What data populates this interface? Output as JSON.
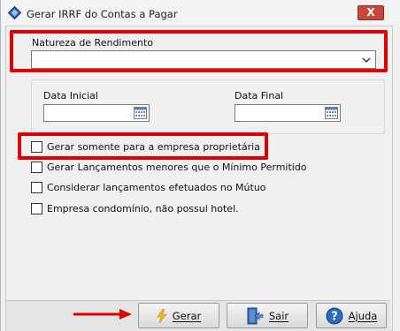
{
  "window": {
    "title": "Gerar IRRF do Contas a Pagar",
    "close_label": "X"
  },
  "form": {
    "natureza_label": "Natureza de Rendimento",
    "natureza_value": "",
    "data_inicial_label": "Data Inicial",
    "data_inicial_value": "",
    "data_final_label": "Data Final",
    "data_final_value": ""
  },
  "checkboxes": [
    {
      "label": "Gerar somente para a empresa proprietária",
      "checked": false
    },
    {
      "label": "Gerar Lançamentos menores que o Mínimo Permitido",
      "checked": false
    },
    {
      "label": "Considerar lançamentos efetuados no Mútuo",
      "checked": false
    },
    {
      "label": "Empresa condomínio, não possui hotel.",
      "checked": false
    }
  ],
  "buttons": {
    "gerar": "Gerar",
    "sair": "Sair",
    "ajuda": "Ajuda"
  },
  "annotation_color": "#e00000"
}
